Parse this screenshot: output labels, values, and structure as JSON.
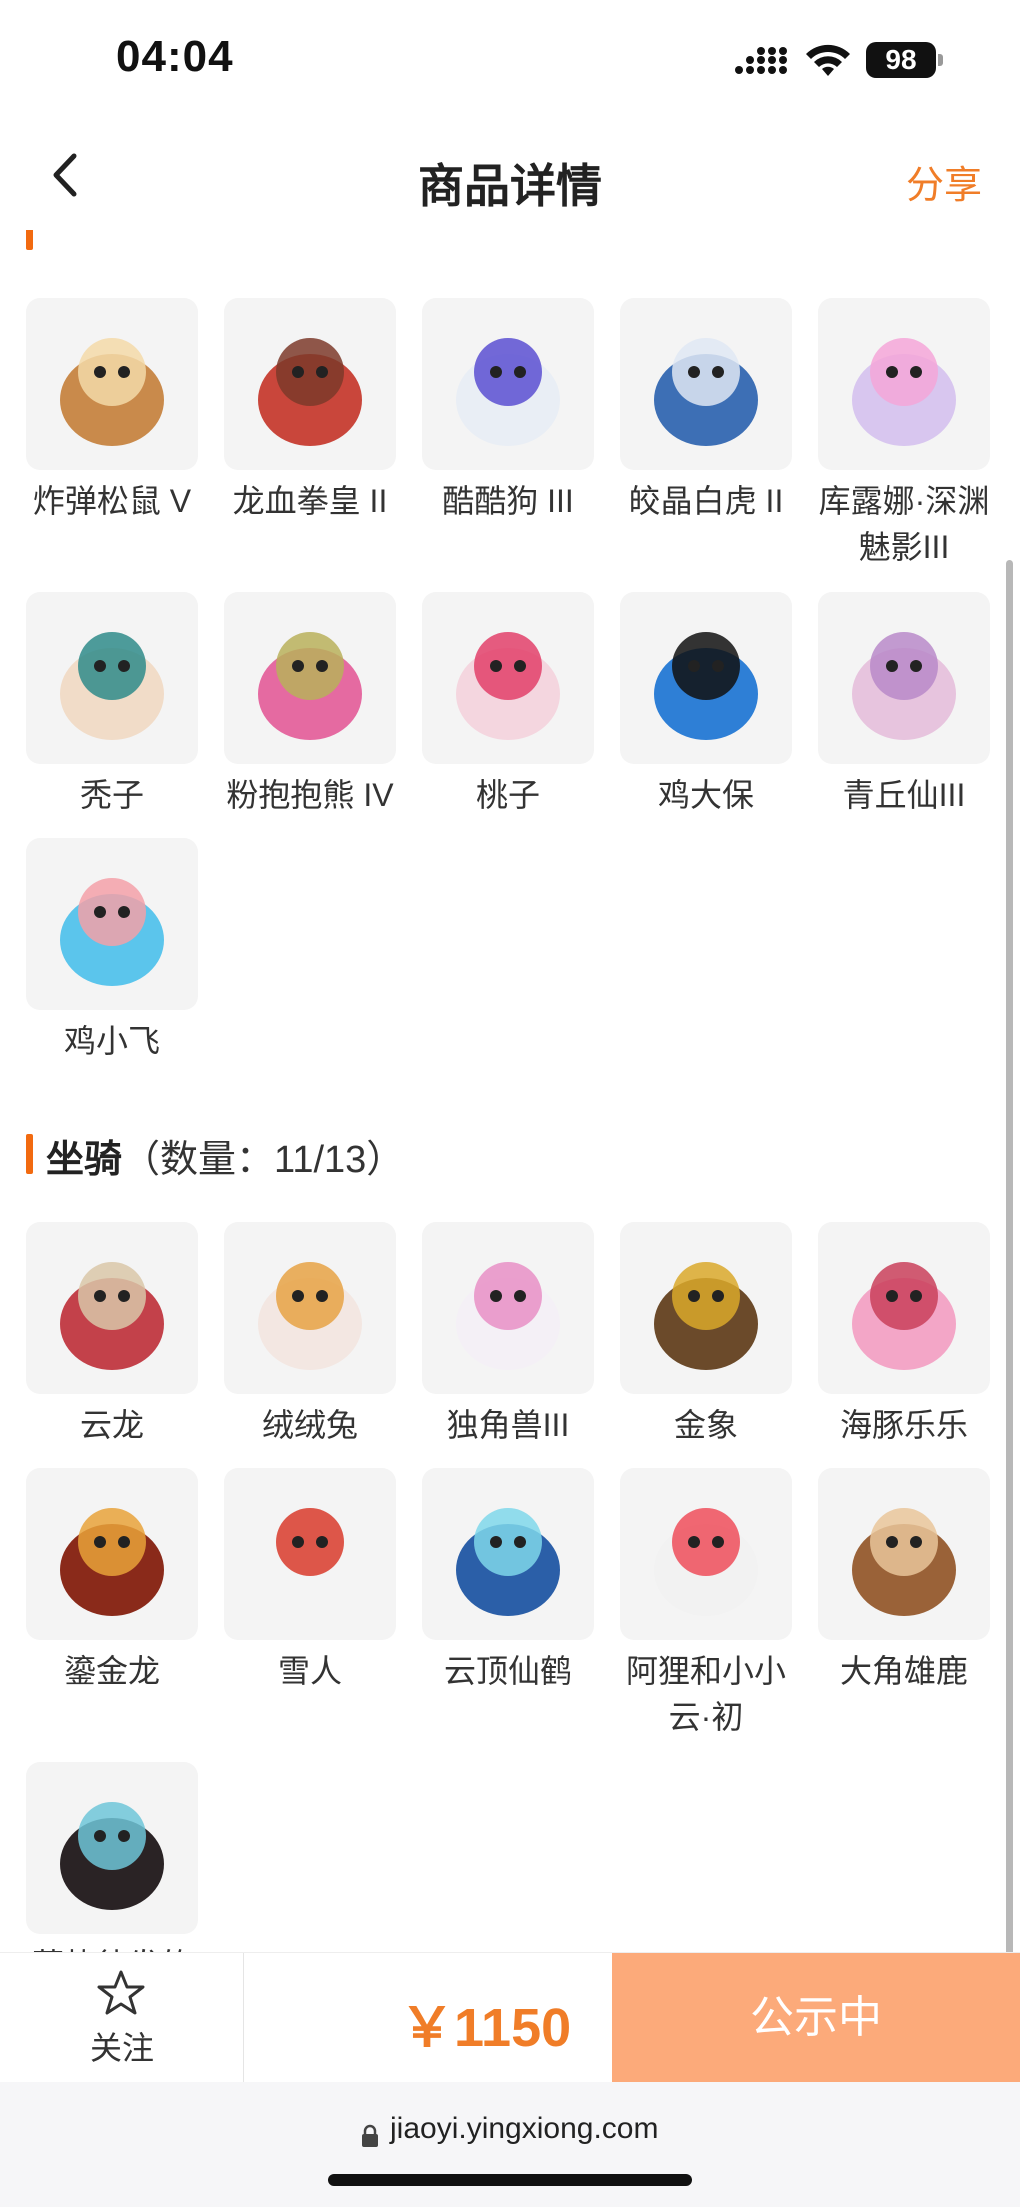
{
  "status_bar": {
    "time": "04:04",
    "battery": "98"
  },
  "header": {
    "title": "商品详情",
    "share_label": "分享"
  },
  "pets": {
    "items": [
      {
        "name": "炸弹松鼠 V",
        "icon": "squirrel-icon"
      },
      {
        "name": "龙血拳皇 II",
        "icon": "dragon-fighter-icon"
      },
      {
        "name": "酷酷狗 III",
        "icon": "cool-dog-icon"
      },
      {
        "name": "皎晶白虎 II",
        "icon": "white-tiger-icon"
      },
      {
        "name": "库露娜·深渊魅影III",
        "icon": "kuluna-icon"
      },
      {
        "name": "秃子",
        "icon": "bald-kid-icon"
      },
      {
        "name": "粉抱抱熊 IV",
        "icon": "pink-bear-icon"
      },
      {
        "name": "桃子",
        "icon": "peach-bunny-icon"
      },
      {
        "name": "鸡大保",
        "icon": "blue-chicken-icon"
      },
      {
        "name": "青丘仙III",
        "icon": "fox-fairy-icon"
      },
      {
        "name": "鸡小飞",
        "icon": "blue-bird-icon"
      }
    ]
  },
  "mounts": {
    "title": "坐骑",
    "count": "（数量：11/13）",
    "items": [
      {
        "name": "云龙",
        "icon": "cloud-dragon-icon"
      },
      {
        "name": "绒绒兔",
        "icon": "fluffy-rabbit-icon"
      },
      {
        "name": "独角兽III",
        "icon": "unicorn-icon"
      },
      {
        "name": "金象",
        "icon": "golden-elephant-icon"
      },
      {
        "name": "海豚乐乐",
        "icon": "dolphin-icon"
      },
      {
        "name": "鎏金龙",
        "icon": "gilded-dragon-icon"
      },
      {
        "name": "雪人",
        "icon": "snowman-icon"
      },
      {
        "name": "云顶仙鹤",
        "icon": "crane-icon"
      },
      {
        "name": "阿狸和小小云·初",
        "icon": "ali-cloud-icon"
      },
      {
        "name": "大角雄鹿",
        "icon": "stag-icon"
      },
      {
        "name": "蓄势待发的",
        "icon": "pig-icon"
      }
    ]
  },
  "bottom_bar": {
    "follow_label": "关注",
    "price": "￥1150",
    "cta_label": "公示中"
  },
  "browser": {
    "url": "jiaoyi.yingxiong.com"
  },
  "colors": {
    "accent": "#f07d28",
    "cta_bg": "#fcaa7a",
    "section_bar": "#f26a10"
  }
}
